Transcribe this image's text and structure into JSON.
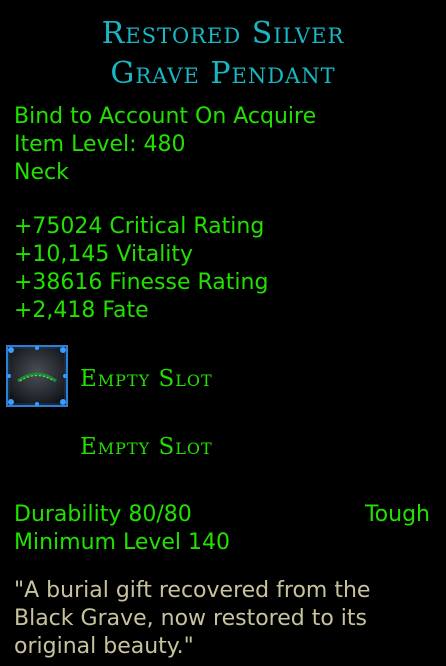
{
  "item": {
    "name_line1": "Restored Silver",
    "name_line2": "Grave Pendant",
    "binding": "Bind to Account On Acquire",
    "item_level": "Item Level: 480",
    "slot": "Neck"
  },
  "stats": [
    "+75024 Critical Rating",
    "+10,145 Vitality",
    "+38616 Finesse Rating",
    "+2,418 Fate"
  ],
  "essence_slots": [
    {
      "label": "Empty Slot",
      "icon": "essence-slot-icon"
    },
    {
      "label": "Empty Slot"
    }
  ],
  "durability": "Durability 80/80",
  "durability_type": "Tough",
  "min_level": "Minimum Level 140",
  "flavor": [
    "\"A burial gift recovered from the",
    "Black Grave, now restored to its",
    "original beauty.\""
  ],
  "colors": {
    "title": "#19b6c4",
    "stat_text": "#22e000",
    "flavor_text": "#c8c39c",
    "background": "#000000"
  }
}
